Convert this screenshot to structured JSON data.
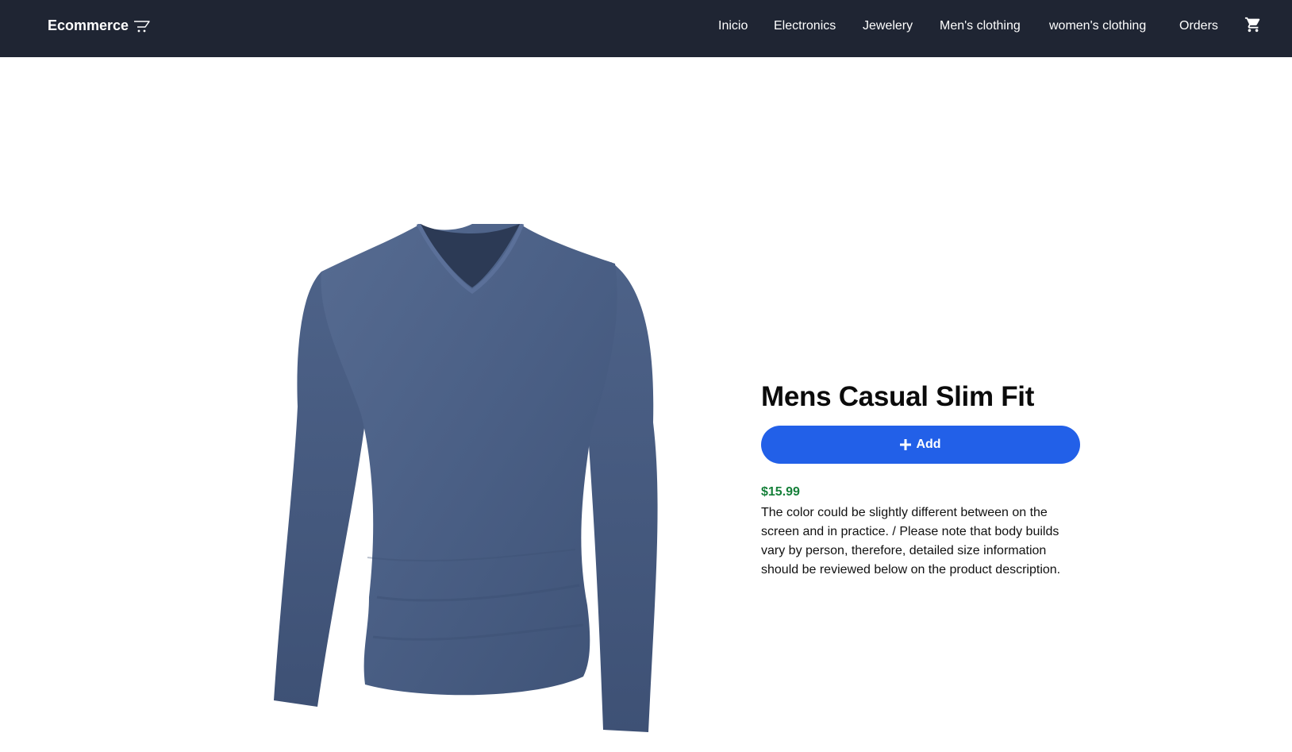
{
  "navbar": {
    "brand": "Ecommerce",
    "brand_icon": "cart-outline-icon",
    "links": [
      {
        "label": "Inicio"
      },
      {
        "label": "Electronics"
      },
      {
        "label": "Jewelery"
      },
      {
        "label": "Men's clothing"
      },
      {
        "label": "women's clothing"
      },
      {
        "label": "Orders"
      }
    ],
    "cart_icon": "shopping-cart-icon"
  },
  "product": {
    "title": "Mens Casual Slim Fit",
    "add_label": "Add",
    "add_icon": "plus-icon",
    "price": "$15.99",
    "description": "The color could be slightly different between on the screen and in practice. / Please note that body builds vary by person, therefore, detailed size information should be reviewed below on the product description.",
    "image": "long-sleeve-v-neck-tshirt-image"
  },
  "colors": {
    "navbar_bg": "#1f2533",
    "button": "#2260e8",
    "price": "#16803a",
    "shirt": "#4a5f85"
  }
}
